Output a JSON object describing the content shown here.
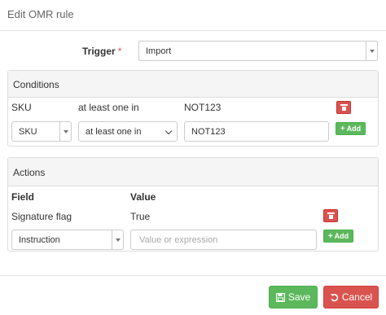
{
  "modal": {
    "title": "Edit OMR rule"
  },
  "trigger": {
    "label": "Trigger",
    "required_mark": "*",
    "value": "Import"
  },
  "conditions": {
    "heading": "Conditions",
    "rows": [
      {
        "field": "SKU",
        "operator": "at least one in",
        "value": "NOT123"
      }
    ],
    "new_row": {
      "field": "SKU",
      "operator": "at least one in",
      "value": "NOT123"
    },
    "add_label": "Add"
  },
  "actions": {
    "heading": "Actions",
    "columns": [
      "Field",
      "Value"
    ],
    "rows": [
      {
        "field": "Signature flag",
        "value": "True"
      }
    ],
    "new_row": {
      "field": "Instruction",
      "value_placeholder": "Value or expression"
    },
    "add_label": "Add"
  },
  "footer": {
    "save_label": "Save",
    "cancel_label": "Cancel"
  },
  "colors": {
    "success": "#5cb85c",
    "danger": "#d9534f",
    "panel_heading": "#f5f5f5"
  },
  "icons": {
    "delete": "trash-icon",
    "add": "plus-icon",
    "save": "floppy-disk-icon",
    "cancel": "undo-icon"
  }
}
